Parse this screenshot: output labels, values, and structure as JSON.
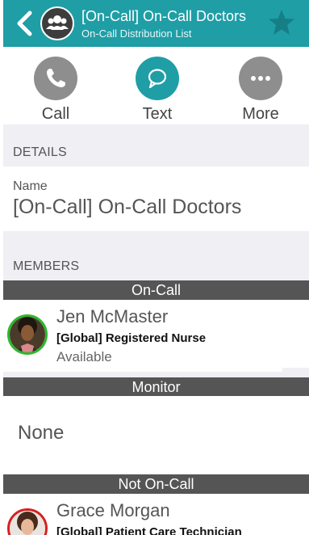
{
  "header": {
    "title": "[On-Call] On-Call Doctors",
    "subtitle": "On-Call Distribution List",
    "icons": [
      "back-chevron-icon",
      "group-icon",
      "star-icon"
    ],
    "color": "#1f9ea6"
  },
  "actions": [
    {
      "label": "Call",
      "icon": "phone-icon",
      "color": "#8e8e8e"
    },
    {
      "label": "Text",
      "icon": "chat-bubble-icon",
      "color": "#1f9ea6"
    },
    {
      "label": "More",
      "icon": "more-dots-icon",
      "color": "#8e8e8e"
    }
  ],
  "details": {
    "heading": "DETAILS",
    "name_label": "Name",
    "name_value": "[On-Call] On-Call Doctors"
  },
  "members": {
    "heading": "MEMBERS",
    "groups": [
      {
        "title": "On-Call",
        "people": [
          {
            "name": "Jen McMaster",
            "role": "[Global] Registered Nurse",
            "status": "Available",
            "ring_color": "#2eb82e"
          }
        ]
      },
      {
        "title": "Monitor",
        "empty_text": "None"
      },
      {
        "title": "Not On-Call",
        "people": [
          {
            "name": "Grace Morgan",
            "role": "[Global] Patient Care Technician",
            "ring_color": "#d62020"
          }
        ]
      }
    ]
  }
}
